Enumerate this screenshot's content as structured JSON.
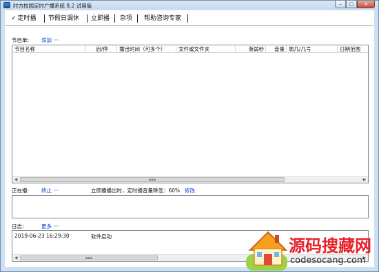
{
  "window": {
    "title": "时方校园定时广播系统 8.2 试用版",
    "minimize": "–",
    "maximize": "□",
    "close": "✕"
  },
  "tabs": [
    {
      "label": "定时播",
      "active": true
    },
    {
      "label": "节假日调休"
    },
    {
      "label": "立即播"
    },
    {
      "label": "杂项"
    },
    {
      "label": "帮助咨询专家"
    }
  ],
  "program": {
    "label": "节目单:",
    "add_link": "添加 ···",
    "columns": [
      "节目名称",
      "启/停",
      "播出时间（可多个）",
      "文件或文件夹",
      "渐弱秒",
      "音量",
      "周几/几号",
      "日期范围"
    ]
  },
  "playing": {
    "label": "正在播:",
    "stop_link": "终止 ···",
    "info": "立即播播出时，定时播音量降低：60%",
    "edit_link": "修改"
  },
  "log": {
    "label": "日志:",
    "more_link": "更多 ···",
    "entries": [
      {
        "time": "2019-06-23 16:29:30",
        "message": "软件启动"
      }
    ]
  },
  "watermark": {
    "title": "源码搜藏网",
    "url": "codesocang.com"
  },
  "colors": {
    "link": "#0a34d6",
    "frame": "#cfe0f1",
    "watermark_red": "#e8202a"
  }
}
